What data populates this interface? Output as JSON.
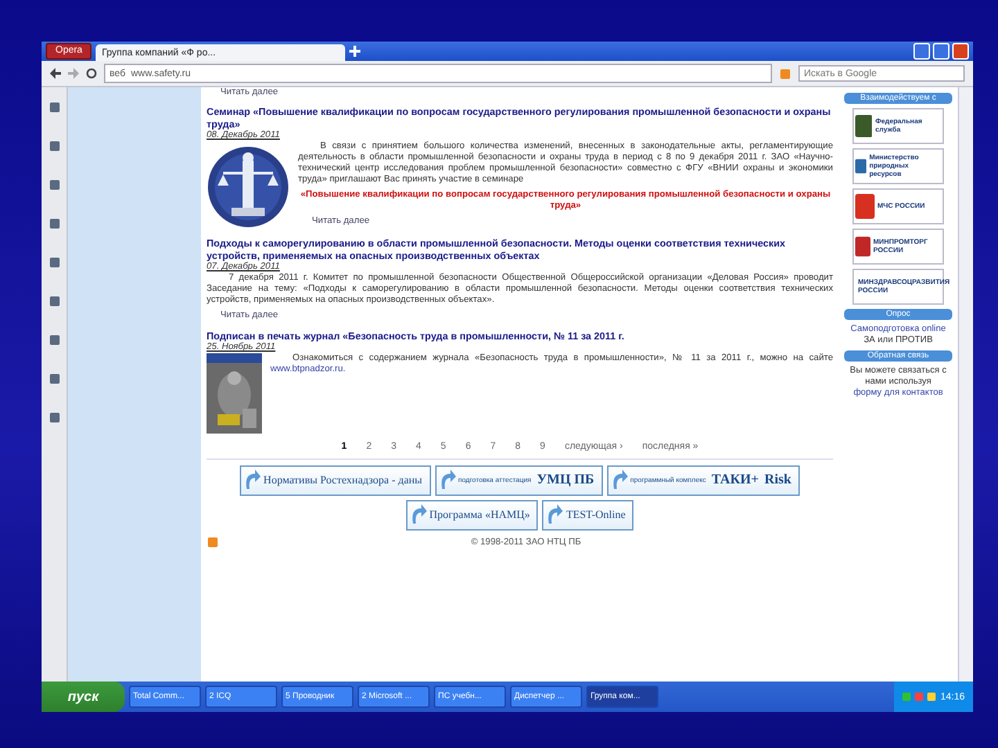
{
  "browser": {
    "menu_button": "Opera",
    "tabs": [
      {
        "label": "Группа компаний «Ф ро...",
        "selected": true
      }
    ],
    "address_label": "веб",
    "url": "www.safety.ru",
    "search": {
      "placeholder": "Искать в Google"
    }
  },
  "page": {
    "top_link": "Читать далее",
    "news": [
      {
        "title": "Семинар «Повышение квалификации по вопросам государственного регулирования промышленной безопасности и охраны труда»",
        "date": "08. Декабрь 2011",
        "kind": "picture",
        "text": "В связи с принятием большого количества изменений, внесенных в законодательные акты, регламентирующие деятельность в области промышленной безопасности и охраны труда в период с 8 по 9 декабря 2011 г. ЗАО «Научно-технический центр исследования проблем промышленной безопасности» совместно с ФГУ «ВНИИ охраны и экономики труда» приглашают Вас принять участие в семинаре",
        "highlight": "«Повышение квалификации по вопросам государственного регулирования промышленной безопасности и охраны труда»",
        "more": "Читать далее"
      },
      {
        "title": "Подходы к саморегулированию в области промышленной безопасности. Методы оценки соответствия технических устройств, применяемых на опасных производственных объектах",
        "date": "07. Декабрь 2011",
        "kind": "text",
        "text": "7 декабря 2011 г. Комитет по промышленной безопасности Общественной Общероссийской организации «Деловая Россия» проводит Заседание на тему: «Подходы к саморегулированию в области промышленной безопасности. Методы оценки соответствия технических устройств, применяемых на опасных производственных объектах».",
        "more": "Читать далее"
      },
      {
        "title": "Подписан в печать журнал «Безопасность труда в промышленности, № 11 за 2011 г.",
        "date": "25. Ноябрь 2011",
        "kind": "picture",
        "text": "Ознакомиться с содержанием журнала «Безопасность труда в промышленности», № 11 за 2011 г., можно на сайте",
        "link": "www.btpnadzor.ru."
      }
    ],
    "pages": [
      {
        "label": "1",
        "selected": true
      },
      {
        "label": "2",
        "selected": false
      },
      {
        "label": "3",
        "selected": false
      },
      {
        "label": "4",
        "selected": false
      },
      {
        "label": "5",
        "selected": false
      },
      {
        "label": "6",
        "selected": false
      },
      {
        "label": "7",
        "selected": false
      },
      {
        "label": "8",
        "selected": false
      },
      {
        "label": "9",
        "selected": false
      },
      {
        "label": "следующая ›",
        "selected": false
      },
      {
        "label": "последняя »",
        "selected": false
      }
    ],
    "banners": [
      [
        "Нормативы Ростехнадзора - даны"
      ],
      [
        "подготовка аттестация",
        "УМЦ ПБ"
      ],
      [
        "программный комплекс",
        "ТАКИ+",
        "Risk"
      ],
      [
        "Программа «НАМЦ»"
      ],
      [
        "TEST-Online"
      ]
    ],
    "copyright": "© 1998-2011 ЗАО НТЦ ПБ"
  },
  "sidebar": {
    "partners_title": "Взаимодействуем с",
    "partners": [
      "Федеральная служба",
      "Министерство природных ресурсов",
      "МЧС РОССИИ",
      "МИНПРОМТОРГ РОССИИ",
      "МИНЗДРАВСОЦРАЗВИТИЯ РОССИИ"
    ],
    "poll_title": "Опрос",
    "poll_text": "Самоподготовка online",
    "poll_choice": "ЗА или ПРОТИВ",
    "feedback_title": "Обратная связь",
    "feedback_text": "Вы можете связаться с нами используя",
    "feedback_link": "форму для контактов"
  },
  "taskbar": {
    "start": "пуск",
    "tasks": [
      {
        "label": "Total Comm...",
        "selected": false
      },
      {
        "label": "2 ICQ",
        "selected": false
      },
      {
        "label": "5 Проводник",
        "selected": false
      },
      {
        "label": "2 Microsoft ...",
        "selected": false
      },
      {
        "label": "ПС учебн...",
        "selected": false
      },
      {
        "label": "Диспетчер ...",
        "selected": false
      },
      {
        "label": "Группа ком...",
        "selected": true
      }
    ],
    "clock": "14:16"
  }
}
